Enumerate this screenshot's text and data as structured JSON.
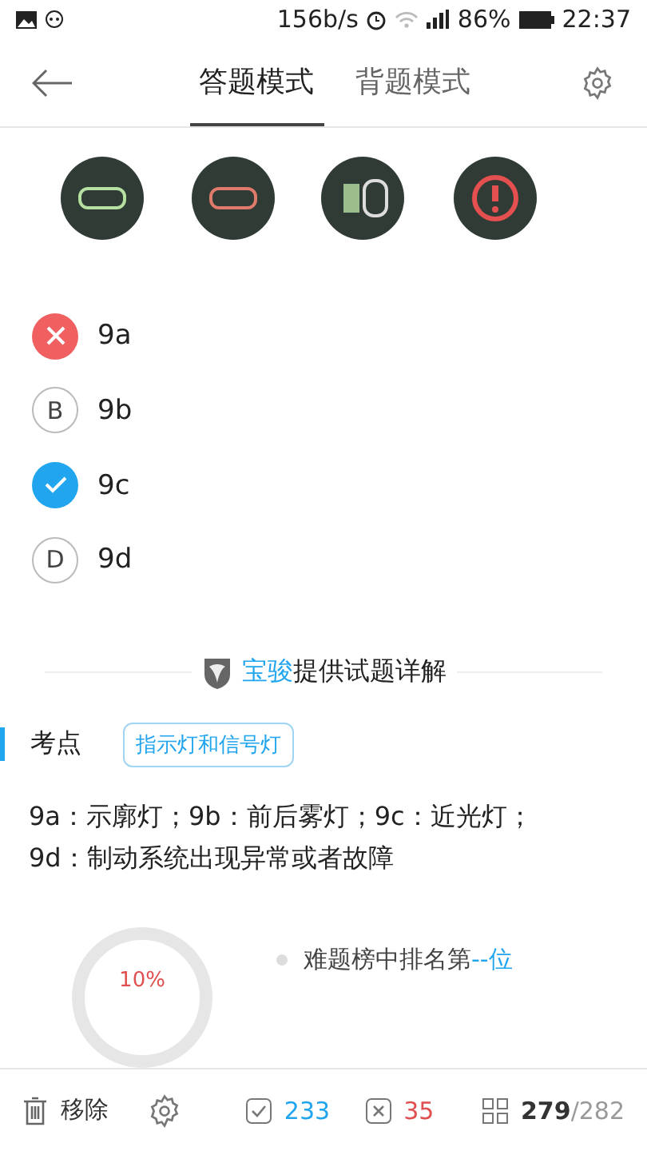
{
  "status_bar": {
    "speed": "156b/s",
    "battery": "86%",
    "time": "22:37"
  },
  "tabs": [
    {
      "label": "答题模式",
      "selected": true
    },
    {
      "label": "背题模式",
      "selected": false
    }
  ],
  "options": [
    {
      "kind": "wrong",
      "label": "9a"
    },
    {
      "kind": "letter",
      "letter": "B",
      "label": "9b"
    },
    {
      "kind": "correct",
      "label": "9c"
    },
    {
      "kind": "letter",
      "letter": "D",
      "label": "9d"
    }
  ],
  "sponsor": {
    "brand": "宝骏",
    "text": "提供试题详解"
  },
  "key_point": {
    "label": "考点",
    "tag": "指示灯和信号灯"
  },
  "explanation": "9a：示廓灯；9b：前后雾灯；9c：近光灯；9d：制动系统出现异常或者故障",
  "stats": {
    "percent": "10%",
    "rank_prefix": "难题榜中排名第",
    "rank_value": "--位"
  },
  "bottom_bar": {
    "remove": "移除",
    "correct_count": "233",
    "wrong_count": "35",
    "current": "279",
    "total": "/282"
  }
}
